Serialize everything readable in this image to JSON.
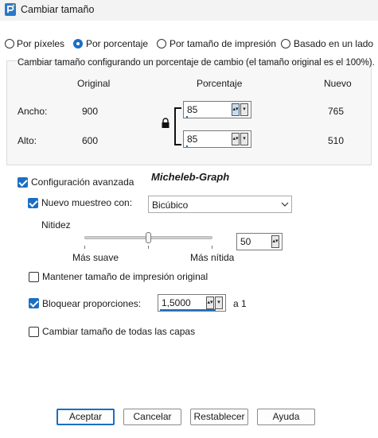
{
  "window": {
    "title": "Cambiar tamaño"
  },
  "modes": [
    {
      "label": "Por píxeles",
      "selected": false
    },
    {
      "label": "Por porcentaje",
      "selected": true
    },
    {
      "label": "Por tamaño de impresión",
      "selected": false
    },
    {
      "label": "Basado en un lado",
      "selected": false
    }
  ],
  "group": {
    "legend": "Cambiar tamaño configurando un porcentaje de cambio (el tamaño original es el 100%).",
    "col_original": "Original",
    "col_percent": "Porcentaje",
    "col_new": "Nuevo",
    "width_label": "Ancho:",
    "width_original": "900",
    "width_percent": "85",
    "width_new": "765",
    "height_label": "Alto:",
    "height_original": "600",
    "height_percent": "85",
    "height_new": "510"
  },
  "watermark": "Micheleb-Graph",
  "advanced": {
    "label": "Configuración avanzada",
    "checked": true,
    "resample_label": "Nuevo muestreo con:",
    "resample_checked": true,
    "resample_value": "Bicúbico",
    "sharpness_label": "Nitidez",
    "sharpness_min_label": "Más suave",
    "sharpness_max_label": "Más nítida",
    "sharpness_value": "50",
    "keep_print_label": "Mantener tamaño de impresión original",
    "keep_print_checked": false,
    "lock_label": "Bloquear proporciones:",
    "lock_checked": true,
    "lock_value": "1,5000",
    "lock_suffix": "a 1",
    "all_layers_label": "Cambiar tamaño de todas las capas",
    "all_layers_checked": false
  },
  "buttons": {
    "accept": "Aceptar",
    "cancel": "Cancelar",
    "reset": "Restablecer",
    "help": "Ayuda"
  },
  "colors": {
    "accent": "#1a6fc4"
  }
}
